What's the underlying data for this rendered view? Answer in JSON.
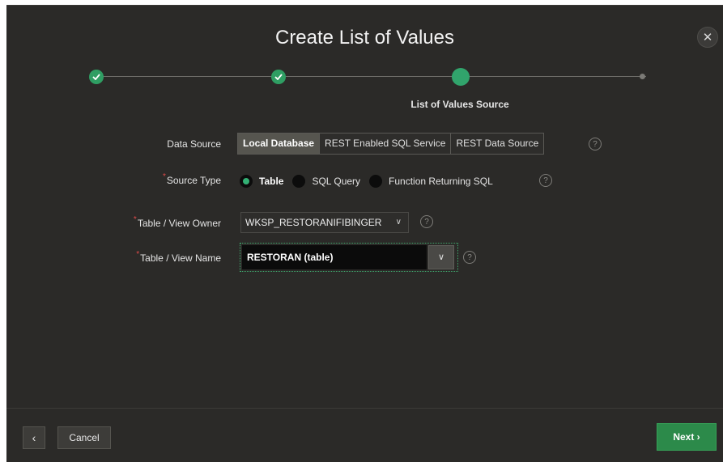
{
  "dialog": {
    "title": "Create List of Values",
    "close_symbol": "✕"
  },
  "wizard": {
    "steps": [
      {
        "state": "complete",
        "icon": "check-icon"
      },
      {
        "state": "complete",
        "icon": "check-icon"
      },
      {
        "state": "current",
        "label": "List of Values Source"
      },
      {
        "state": "upcoming"
      }
    ],
    "current_label": "List of Values Source"
  },
  "form": {
    "data_source": {
      "label": "Data Source",
      "options": [
        "Local Database",
        "REST Enabled SQL Service",
        "REST Data Source"
      ],
      "selected": "Local Database"
    },
    "source_type": {
      "label": "Source Type",
      "required": true,
      "options": [
        "Table",
        "SQL Query",
        "Function Returning SQL"
      ],
      "selected": "Table"
    },
    "table_view_owner": {
      "label": "Table / View Owner",
      "required": true,
      "value": "WKSP_RESTORANIFIBINGER"
    },
    "table_view_name": {
      "label": "Table / View Name",
      "required": true,
      "value": "RESTORAN (table)"
    },
    "help_symbol": "?",
    "required_marker": "*"
  },
  "footer": {
    "back_symbol": "‹",
    "cancel_label": "Cancel",
    "next_label": "Next ›"
  },
  "colors": {
    "background": "#2b2a28",
    "accent_green": "#31a46c",
    "next_button": "#2c8a4a"
  }
}
